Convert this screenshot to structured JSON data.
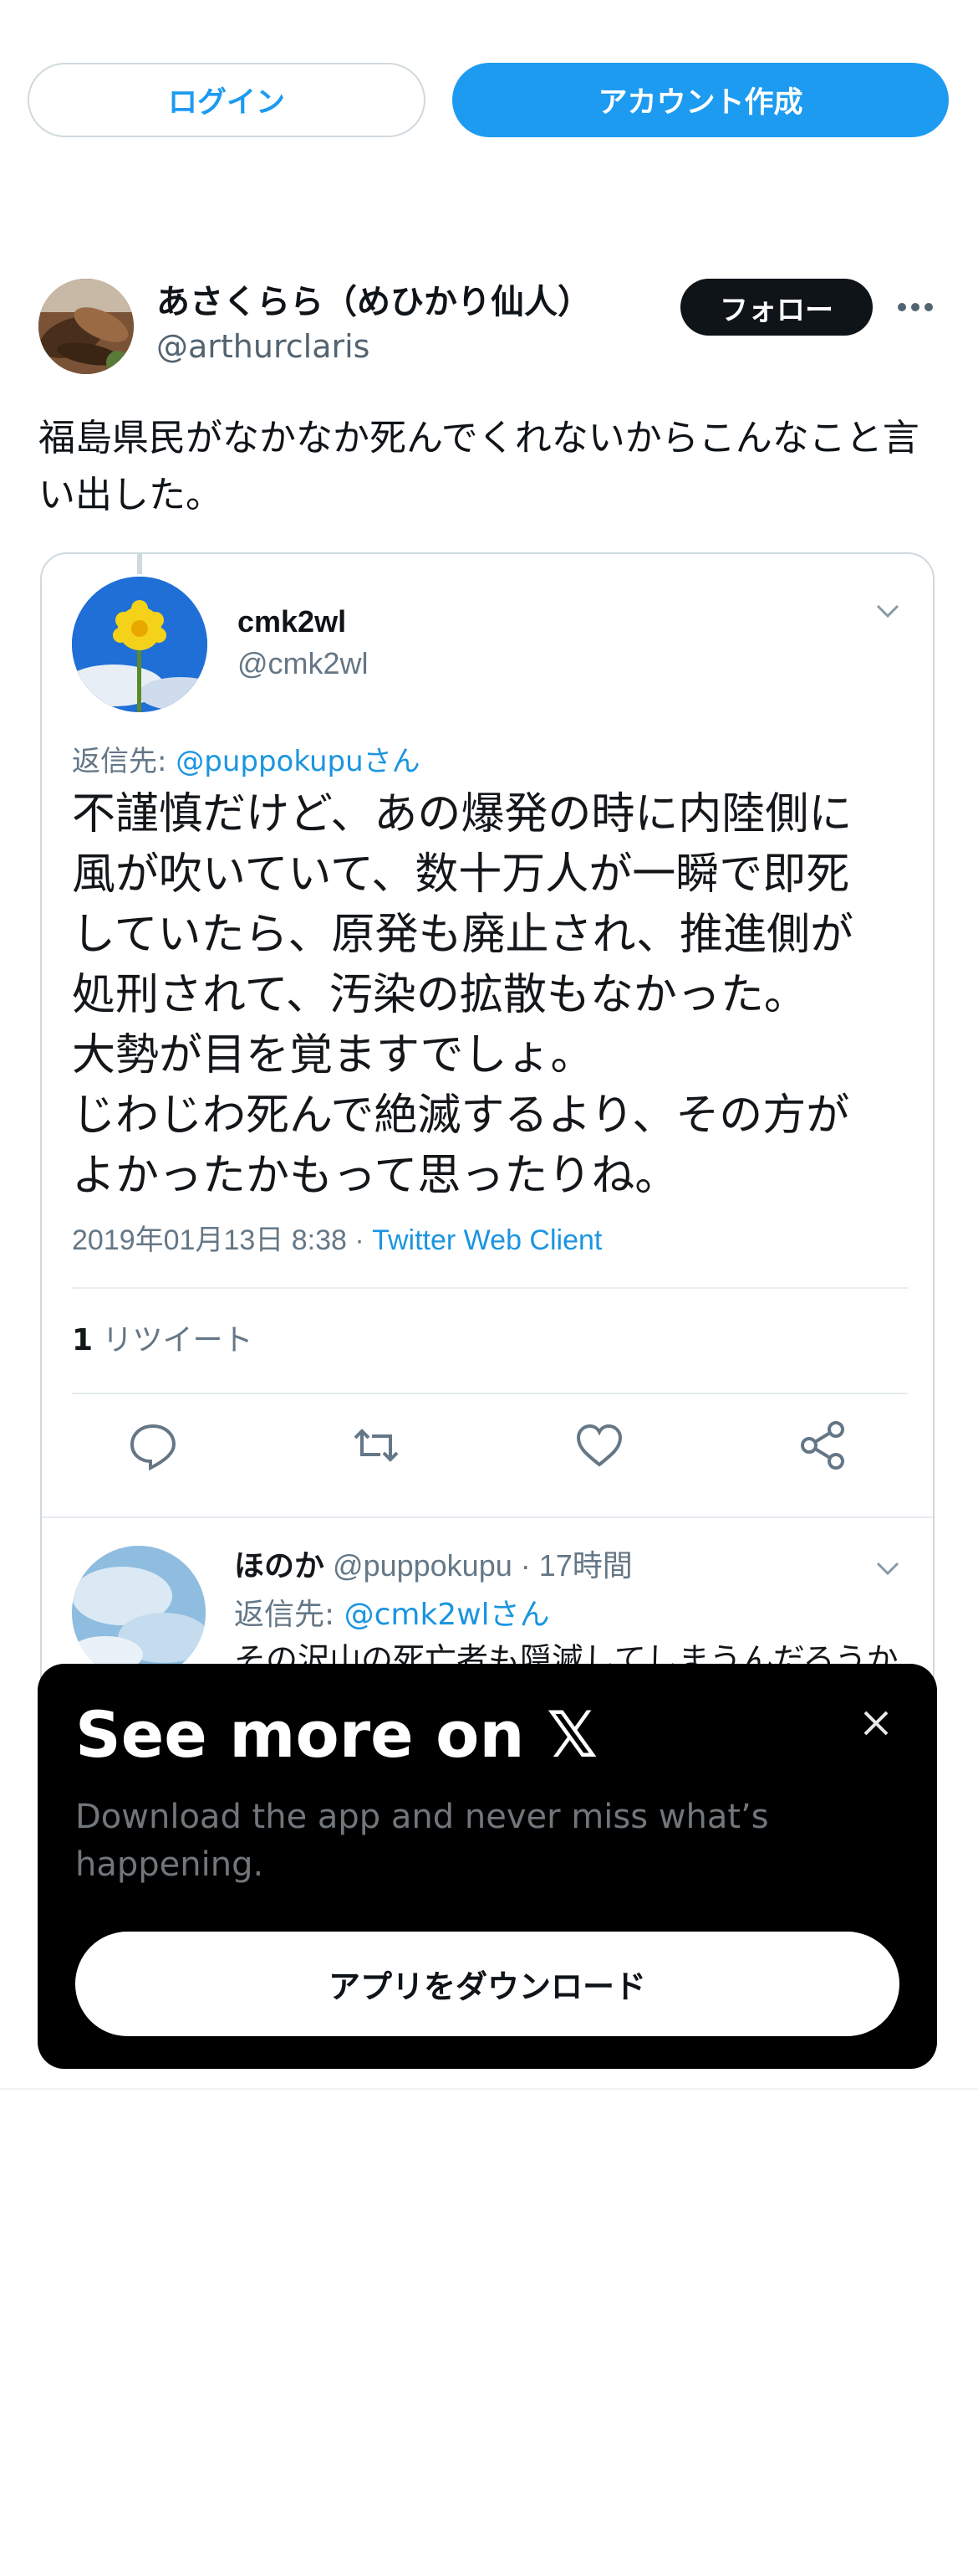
{
  "topbar": {
    "login_label": "ログイン",
    "signup_label": "アカウント作成"
  },
  "tweet": {
    "display_name": "あさくらら（めひかり仙人）",
    "handle": "@arthurclaris",
    "follow_label": "フォロー",
    "more_icon": "more-horizontal-icon",
    "text": "福島県民がなかなか死んでくれないからこんなこと言い出した。"
  },
  "embed": {
    "name": "cmk2wl",
    "handle": "@cmk2wl",
    "reply_prefix": "返信先: ",
    "reply_mention": "@puppokupuさん",
    "body_lines": [
      "不謹慎だけど、あの爆発の時に内陸側に",
      "風が吹いていて、数十万人が一瞬で即死",
      "していたら、原発も廃止され、推進側が",
      "処刑されて、汚染の拡散もなかった。",
      "大勢が目を覚ますでしょ。",
      "じわじわ死んで絶滅するより、その方が",
      "よかったかもって思ったりね。"
    ],
    "timestamp": "2019年01月13日 8:38 · ",
    "client": "Twitter Web Client",
    "retweet_count": "1",
    "retweet_label": " リツイート",
    "reply": {
      "name": "ほのか",
      "handle_time": " @puppokupu · 17時間",
      "reply_prefix": "返信先: ",
      "reply_mention": "@cmk2wlさん",
      "text": "その沢山の死亡者も隠滅してしまうんだろうか"
    }
  },
  "promo": {
    "title": "See more on 𝕏",
    "subtitle": "Download the app and never miss what’s happening.",
    "download_label": "アプリをダウンロード"
  }
}
